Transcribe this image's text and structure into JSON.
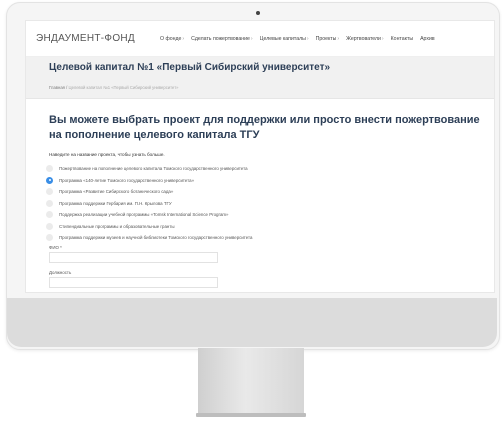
{
  "site": {
    "logo": "ЭНДАУМЕНТ-ФОНД",
    "nav": [
      {
        "label": "О фонде",
        "has_caret": true
      },
      {
        "label": "Сделать пожертвование",
        "has_caret": true
      },
      {
        "label": "Целевые капиталы",
        "has_caret": true
      },
      {
        "label": "Проекты",
        "has_caret": true
      },
      {
        "label": "Жертвователи",
        "has_caret": true
      },
      {
        "label": "Контакты",
        "has_caret": false
      },
      {
        "label": "Архив",
        "has_caret": false
      }
    ],
    "nav_caret": "›"
  },
  "page": {
    "title": "Целевой капитал №1 «Первый Сибирский университет»",
    "breadcrumb": {
      "home": "Главная",
      "separator": "/",
      "current": "Целевой капитал №1 «Первый Сибирский университет»"
    }
  },
  "form": {
    "heading": "Вы можете выбрать проект для поддержки или просто внести пожертвование на пополнение целевого капитала ТГУ",
    "hint": "Наведите на название проекта, чтобы узнать больше.",
    "options": [
      {
        "label": "Пожертвование на пополнение целевого капитала Томского государственного университета",
        "selected": false
      },
      {
        "label": "Программа «140-летие Томского государственного университета»",
        "selected": true
      },
      {
        "label": "Программа «Развитие Сибирского ботанического сада»",
        "selected": false
      },
      {
        "label": "Программа поддержки Гербария им. П.Н. Крылова ТГУ",
        "selected": false
      },
      {
        "label": "Поддержка реализации учебной программы «Tomsk International Science Program»",
        "selected": false
      },
      {
        "label": "Стипендиальные программы и образовательные гранты",
        "selected": false
      },
      {
        "label": "Программа поддержки музеев и научной библиотеки Томского государственного университета",
        "selected": false
      }
    ],
    "fio_label": "ФИО *",
    "fio_value": "",
    "position_label": "Должность",
    "position_value": ""
  },
  "colors": {
    "title": "#2d3f57",
    "accent_radio": "#3a8ee6",
    "band": "#f1f1f1"
  }
}
